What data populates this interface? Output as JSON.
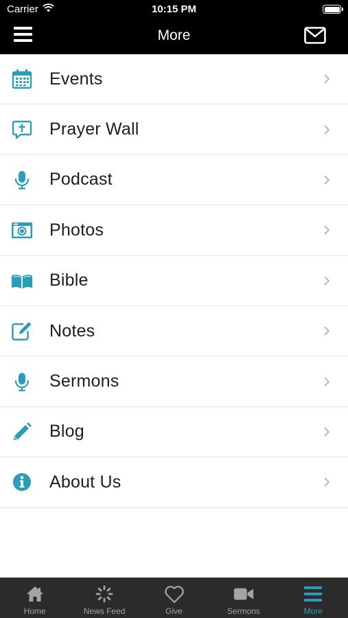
{
  "status": {
    "carrier": "Carrier",
    "time": "10:15 PM"
  },
  "header": {
    "title": "More"
  },
  "menu": {
    "items": [
      {
        "label": "Events",
        "icon": "calendar-icon"
      },
      {
        "label": "Prayer Wall",
        "icon": "prayer-bubble-icon"
      },
      {
        "label": "Podcast",
        "icon": "microphone-icon"
      },
      {
        "label": "Photos",
        "icon": "camera-icon"
      },
      {
        "label": "Bible",
        "icon": "open-book-icon"
      },
      {
        "label": "Notes",
        "icon": "edit-note-icon"
      },
      {
        "label": "Sermons",
        "icon": "microphone-icon"
      },
      {
        "label": "Blog",
        "icon": "pencil-icon"
      },
      {
        "label": "About Us",
        "icon": "info-icon"
      }
    ]
  },
  "tabs": [
    {
      "label": "Home",
      "icon": "home-icon",
      "active": false
    },
    {
      "label": "News Feed",
      "icon": "refresh-icon",
      "active": false
    },
    {
      "label": "Give",
      "icon": "heart-icon",
      "active": false
    },
    {
      "label": "Sermons",
      "icon": "video-camera-icon",
      "active": false
    },
    {
      "label": "More",
      "icon": "menu-icon",
      "active": true
    }
  ],
  "colors": {
    "accent": "#2a9db8",
    "bar": "#000000",
    "tab_bar": "#2b2b2b",
    "tab_inactive": "#a4a4a4"
  }
}
